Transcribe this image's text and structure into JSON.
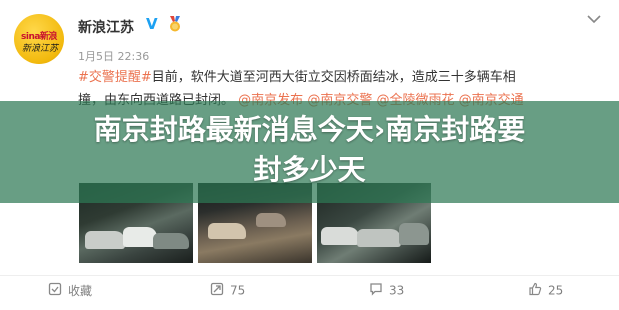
{
  "post": {
    "account_name": "新浪江苏",
    "avatar_logo_text": "sina新浪",
    "avatar_script_text": "新浪江苏",
    "time": "1月5日 22:36",
    "text_tag": "#交警提醒#",
    "text_body_1": "目前，软件大道至河西大街立交因桥面结冰，造成三十多辆车相",
    "text_body_2": "撞，由东向西道路已封闭。",
    "mentions": [
      "@南京发布",
      "@南京交警",
      "@全陵微雨花",
      "@南京交通"
    ]
  },
  "banner": {
    "title_line_1": "南京封路最新消息今天›南京封路要",
    "title_line_2": "封多少天"
  },
  "actions": {
    "favorite_label": "收藏",
    "repost_count": "75",
    "comment_count": "33",
    "like_count": "25"
  },
  "colors": {
    "accent": "#eb7350",
    "banner": "#2e7854",
    "verified": "#1da1f2"
  },
  "icons": [
    "chevron-down-icon",
    "verified-icon",
    "medal-icon",
    "favorite-icon",
    "repost-icon",
    "comment-icon",
    "like-icon"
  ]
}
